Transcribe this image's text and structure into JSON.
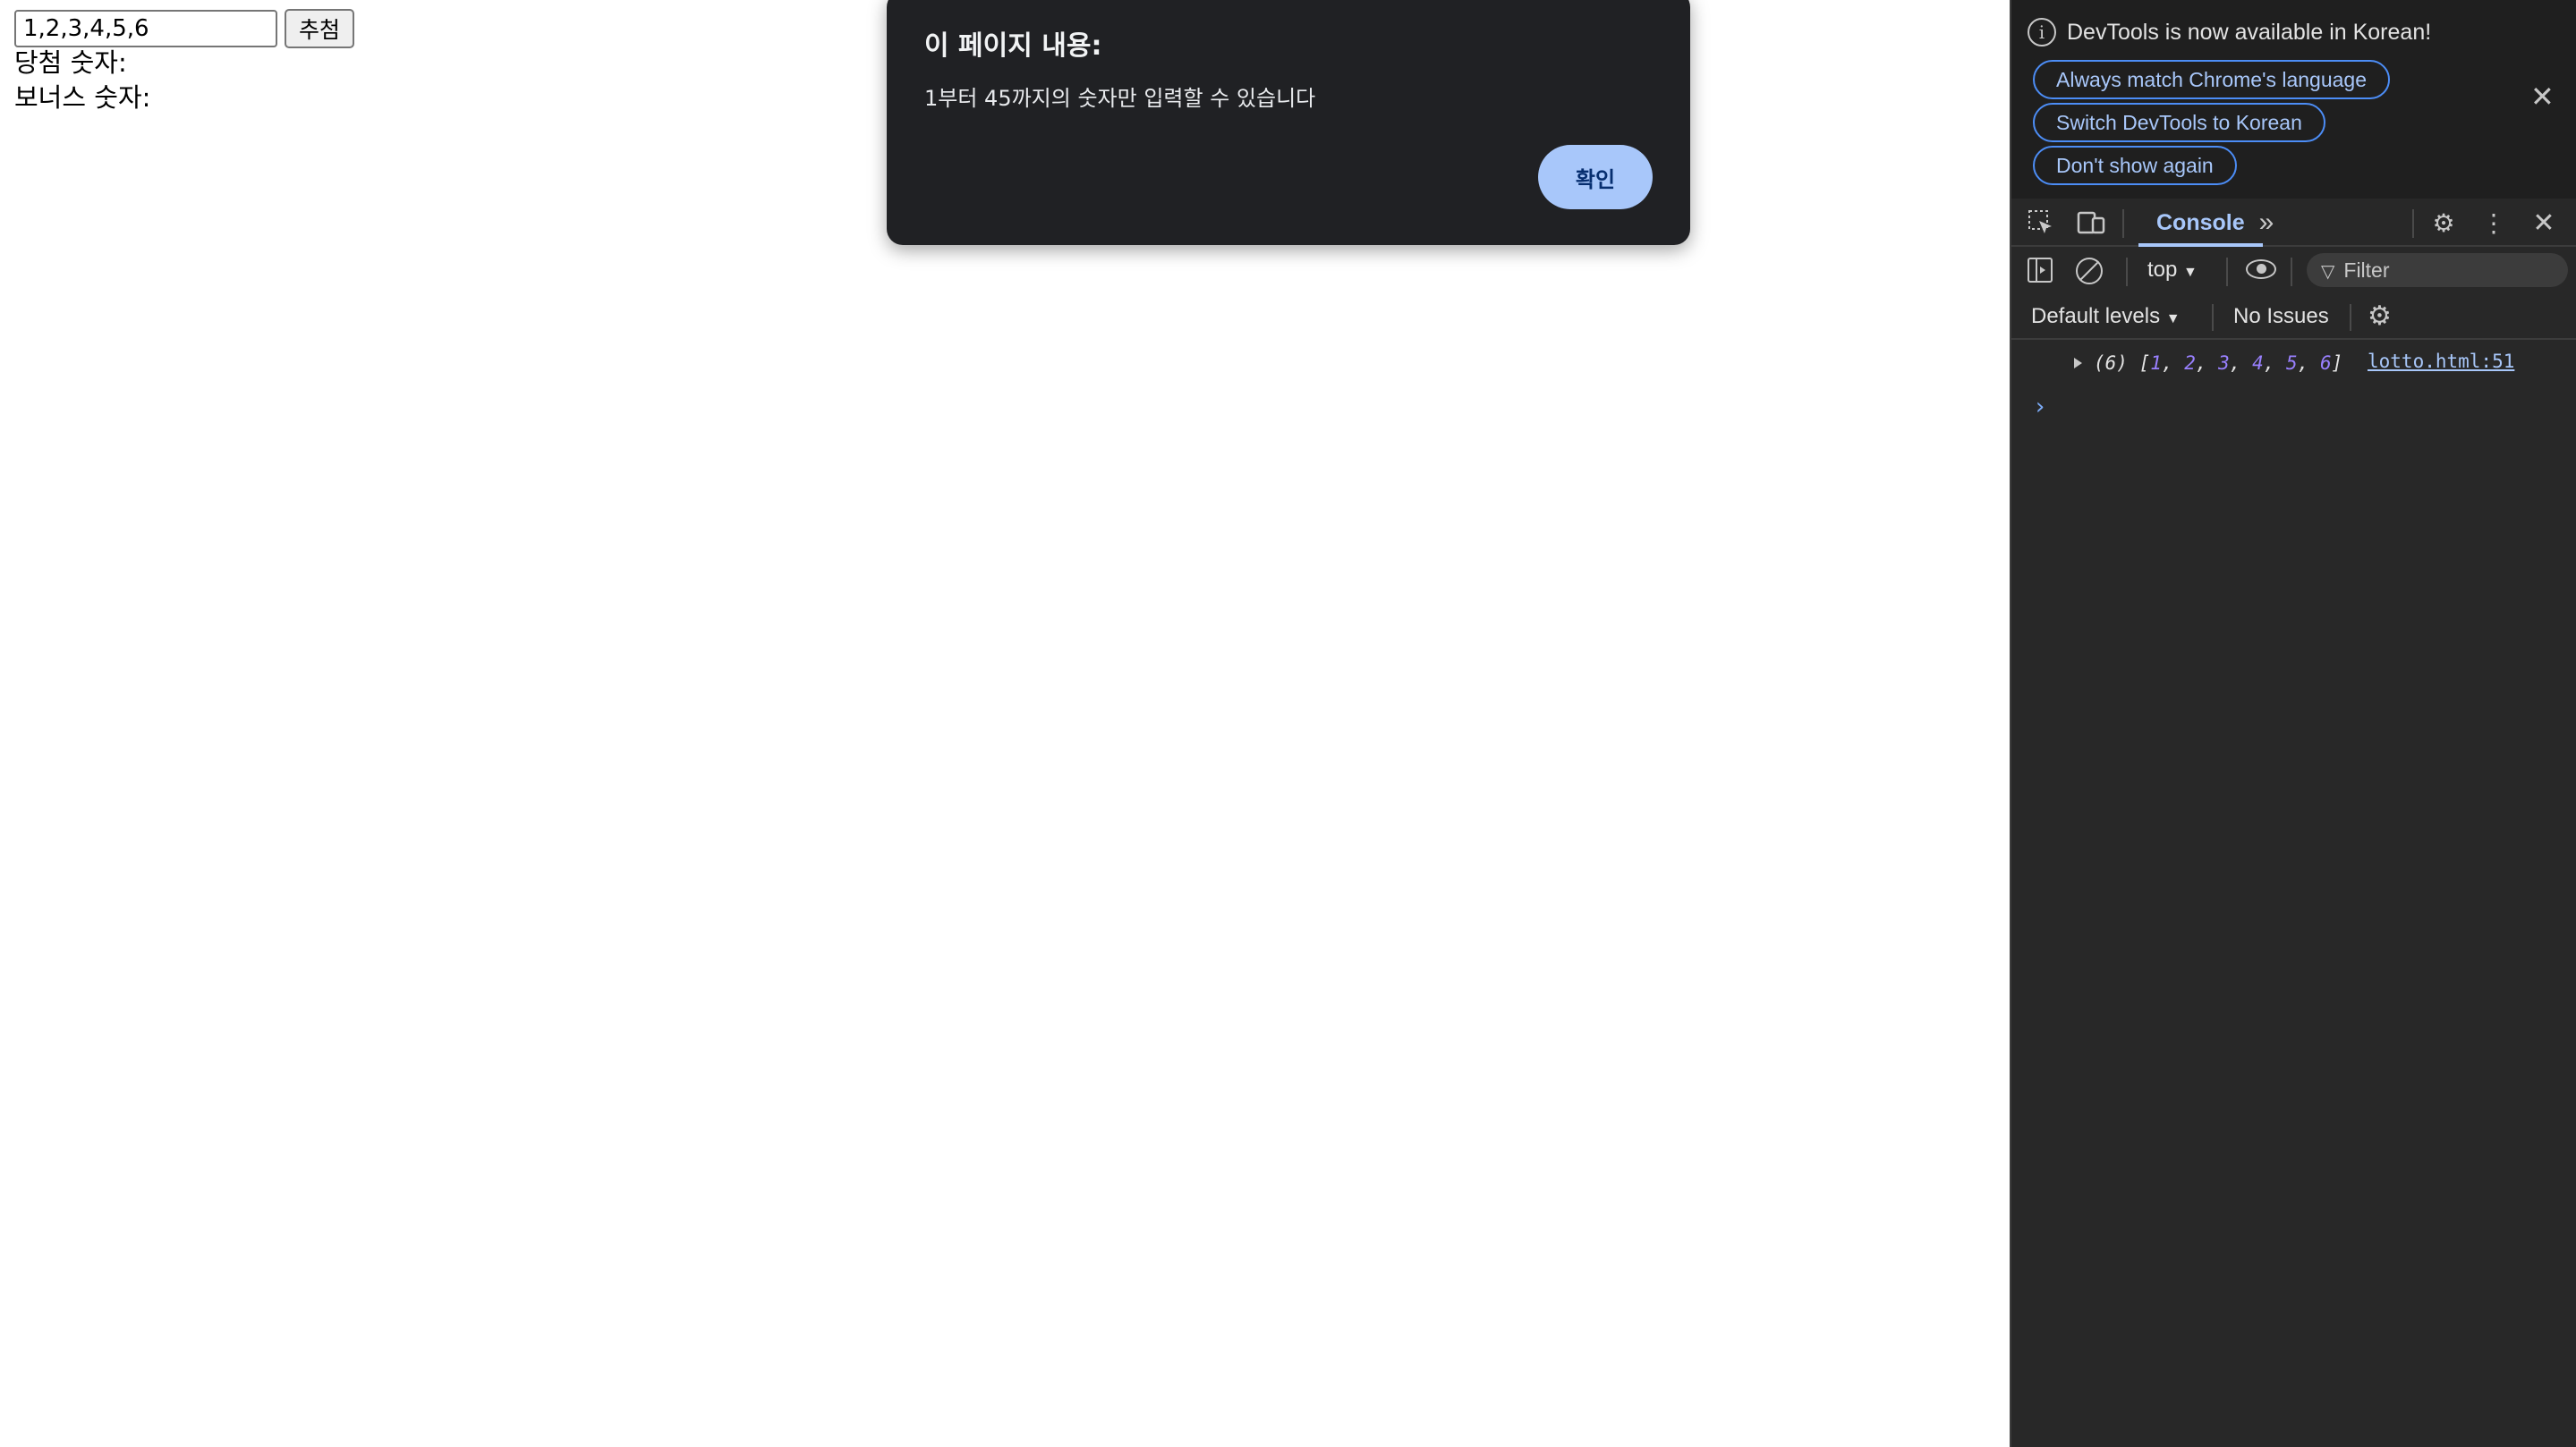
{
  "page": {
    "input_value": "1,2,3,4,5,6",
    "draw_button_label": "추첨",
    "winning_label": "당첨 숫자:",
    "bonus_label": "보너스 숫자:"
  },
  "alert": {
    "title": "이 페이지 내용:",
    "message": "1부터 45까지의 숫자만 입력할 수 있습니다",
    "ok_label": "확인"
  },
  "devtools": {
    "infobar": {
      "message": "DevTools is now available in Korean!",
      "buttons": [
        "Always match Chrome's language",
        "Switch DevTools to Korean",
        "Don't show again"
      ]
    },
    "tabs": {
      "active": "Console"
    },
    "console": {
      "context": "top",
      "filter_placeholder": "Filter",
      "levels": "Default levels",
      "issues": "No Issues",
      "log": {
        "count": "(6)",
        "values": [
          "1",
          "2",
          "3",
          "4",
          "5",
          "6"
        ],
        "source": "lotto.html:51"
      }
    },
    "colors": {
      "accent": "#a8c7fa",
      "background": "#282828",
      "array_number": "#9980ff"
    }
  }
}
